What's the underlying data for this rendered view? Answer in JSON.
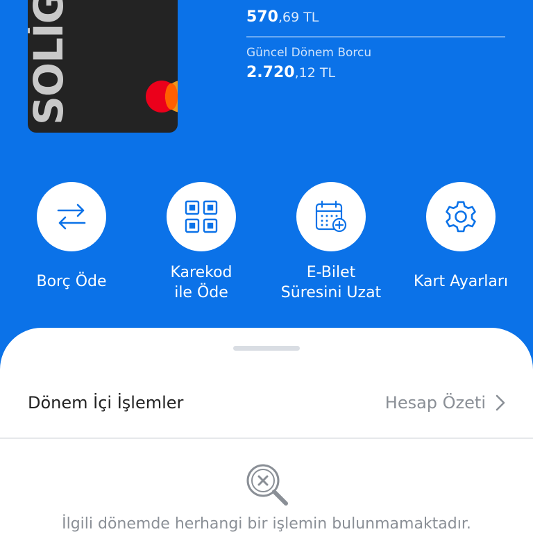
{
  "card": {
    "brand": "SOLİG"
  },
  "balances": {
    "first": {
      "amount_int": "570",
      "amount_dec": ",69 TL"
    },
    "second": {
      "label": "Güncel Dönem Borcu",
      "amount_int": "2.720",
      "amount_dec": ",12 TL"
    }
  },
  "actions": [
    {
      "label": "Borç Öde",
      "icon": "transfer-arrows-icon"
    },
    {
      "label": "Karekod\nile Öde",
      "icon": "qr-code-icon"
    },
    {
      "label": "E-Bilet\nSüresini Uzat",
      "icon": "calendar-add-icon"
    },
    {
      "label": "Kart Ayarları",
      "icon": "gear-icon"
    }
  ],
  "transactions": {
    "title": "Dönem İçi İşlemler",
    "link": "Hesap Özeti",
    "empty_message": "İlgili dönemde herhangi bir işlemin bulunmamaktadır."
  },
  "colors": {
    "primary": "#0b72e8",
    "sheet": "#ffffff",
    "muted": "#8a8f96"
  }
}
